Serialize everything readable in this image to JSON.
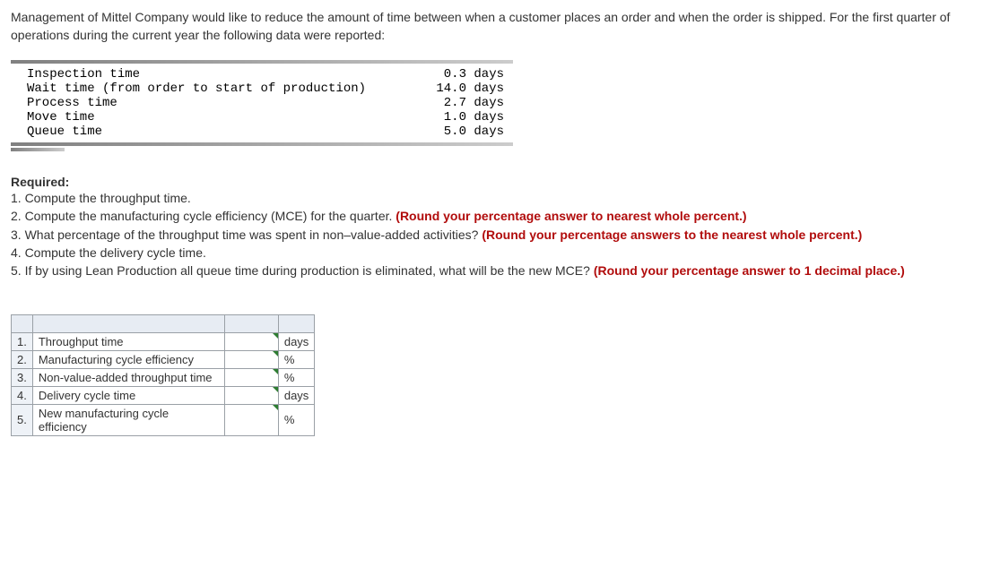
{
  "intro": "Management of Mittel Company would like to reduce the amount of time between when a customer places an order and when the order is shipped. For the first quarter of operations during the current year the following data were reported:",
  "data_rows": [
    {
      "label": "Inspection time",
      "value": "0.3 days"
    },
    {
      "label": "Wait time (from order to start of production)",
      "value": "14.0 days"
    },
    {
      "label": "Process time",
      "value": "2.7 days"
    },
    {
      "label": "Move time",
      "value": "1.0 days"
    },
    {
      "label": "Queue time",
      "value": "5.0 days"
    }
  ],
  "required_heading": "Required:",
  "requirements": {
    "r1": "1. Compute the throughput time.",
    "r2a": "2. Compute the manufacturing cycle efficiency (MCE) for the quarter. ",
    "r2b": "(Round your percentage answer to nearest whole percent.)",
    "r3a": "3. What percentage of the throughput time was spent in non–value-added activities? ",
    "r3b": "(Round your percentage answers to the nearest whole percent.)",
    "r4": "4. Compute the delivery cycle time.",
    "r5a": "5. If by using Lean Production all queue time during production is eliminated, what will be the new MCE? ",
    "r5b": "(Round your percentage answer to 1 decimal place.)"
  },
  "answer_rows": [
    {
      "num": "1.",
      "label": "Throughput time",
      "unit": "days"
    },
    {
      "num": "2.",
      "label": "Manufacturing cycle efficiency",
      "unit": "%"
    },
    {
      "num": "3.",
      "label": "Non-value-added throughput time",
      "unit": "%"
    },
    {
      "num": "4.",
      "label": "Delivery cycle time",
      "unit": "days"
    },
    {
      "num": "5.",
      "label": "New manufacturing cycle efficiency",
      "unit": "%"
    }
  ]
}
